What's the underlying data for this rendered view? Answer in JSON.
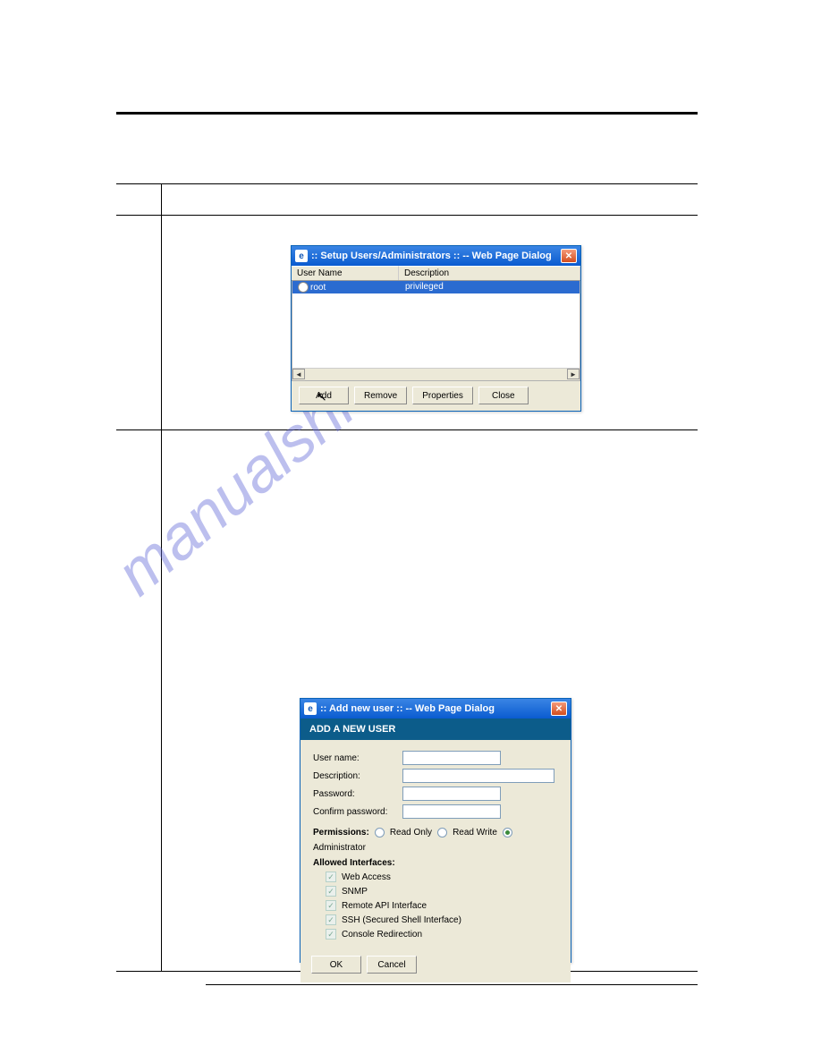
{
  "watermark": "manualshive.com",
  "dialog1": {
    "title": ":: Setup Users/Administrators :: -- Web Page Dialog",
    "columns": {
      "user": "User Name",
      "desc": "Description"
    },
    "rows": [
      {
        "user": "root",
        "desc": "privileged"
      }
    ],
    "buttons": {
      "add": "Add",
      "remove": "Remove",
      "properties": "Properties",
      "close": "Close"
    }
  },
  "dialog2": {
    "title": ":: Add new user :: -- Web Page Dialog",
    "header": "ADD A NEW USER",
    "fields": {
      "username_label": "User name:",
      "description_label": "Description:",
      "password_label": "Password:",
      "confirm_label": "Confirm password:",
      "username": "",
      "description": "",
      "password": "",
      "confirm": ""
    },
    "permissions_label": "Permissions:",
    "permissions": {
      "readonly": "Read Only",
      "readwrite": "Read Write",
      "admin": "Administrator",
      "selected": "admin"
    },
    "allowed_label": "Allowed Interfaces:",
    "interfaces": [
      "Web Access",
      "SNMP",
      "Remote API Interface",
      "SSH (Secured Shell Interface)",
      "Console Redirection"
    ],
    "buttons": {
      "ok": "OK",
      "cancel": "Cancel"
    }
  }
}
